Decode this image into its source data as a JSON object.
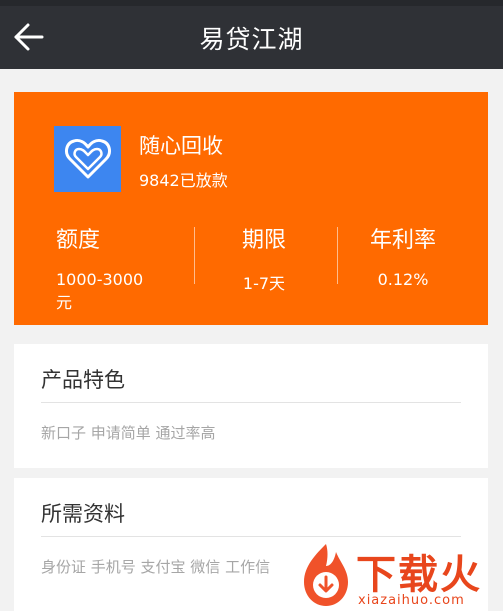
{
  "nav": {
    "title": "易贷江湖",
    "back_icon": "arrow-left-icon"
  },
  "product": {
    "name": "随心回收",
    "lent_count": "9842已放款",
    "logo_icon": "heart-icon",
    "logo_color": "#3d86f0",
    "accent_color": "#ff6a00"
  },
  "stats": [
    {
      "label": "额度",
      "value": "1000-3000元"
    },
    {
      "label": "期限",
      "value": "1-7天"
    },
    {
      "label": "年利率",
      "value": "0.12%"
    }
  ],
  "features": {
    "heading": "产品特色",
    "text": "新口子 申请简单 通过率高"
  },
  "materials": {
    "heading": "所需资料",
    "text": "身份证 手机号 支付宝 微信 工作信"
  },
  "watermark": {
    "brand": "下载火",
    "url": "xiazaihuo.com",
    "icon": "flame-download-icon"
  }
}
